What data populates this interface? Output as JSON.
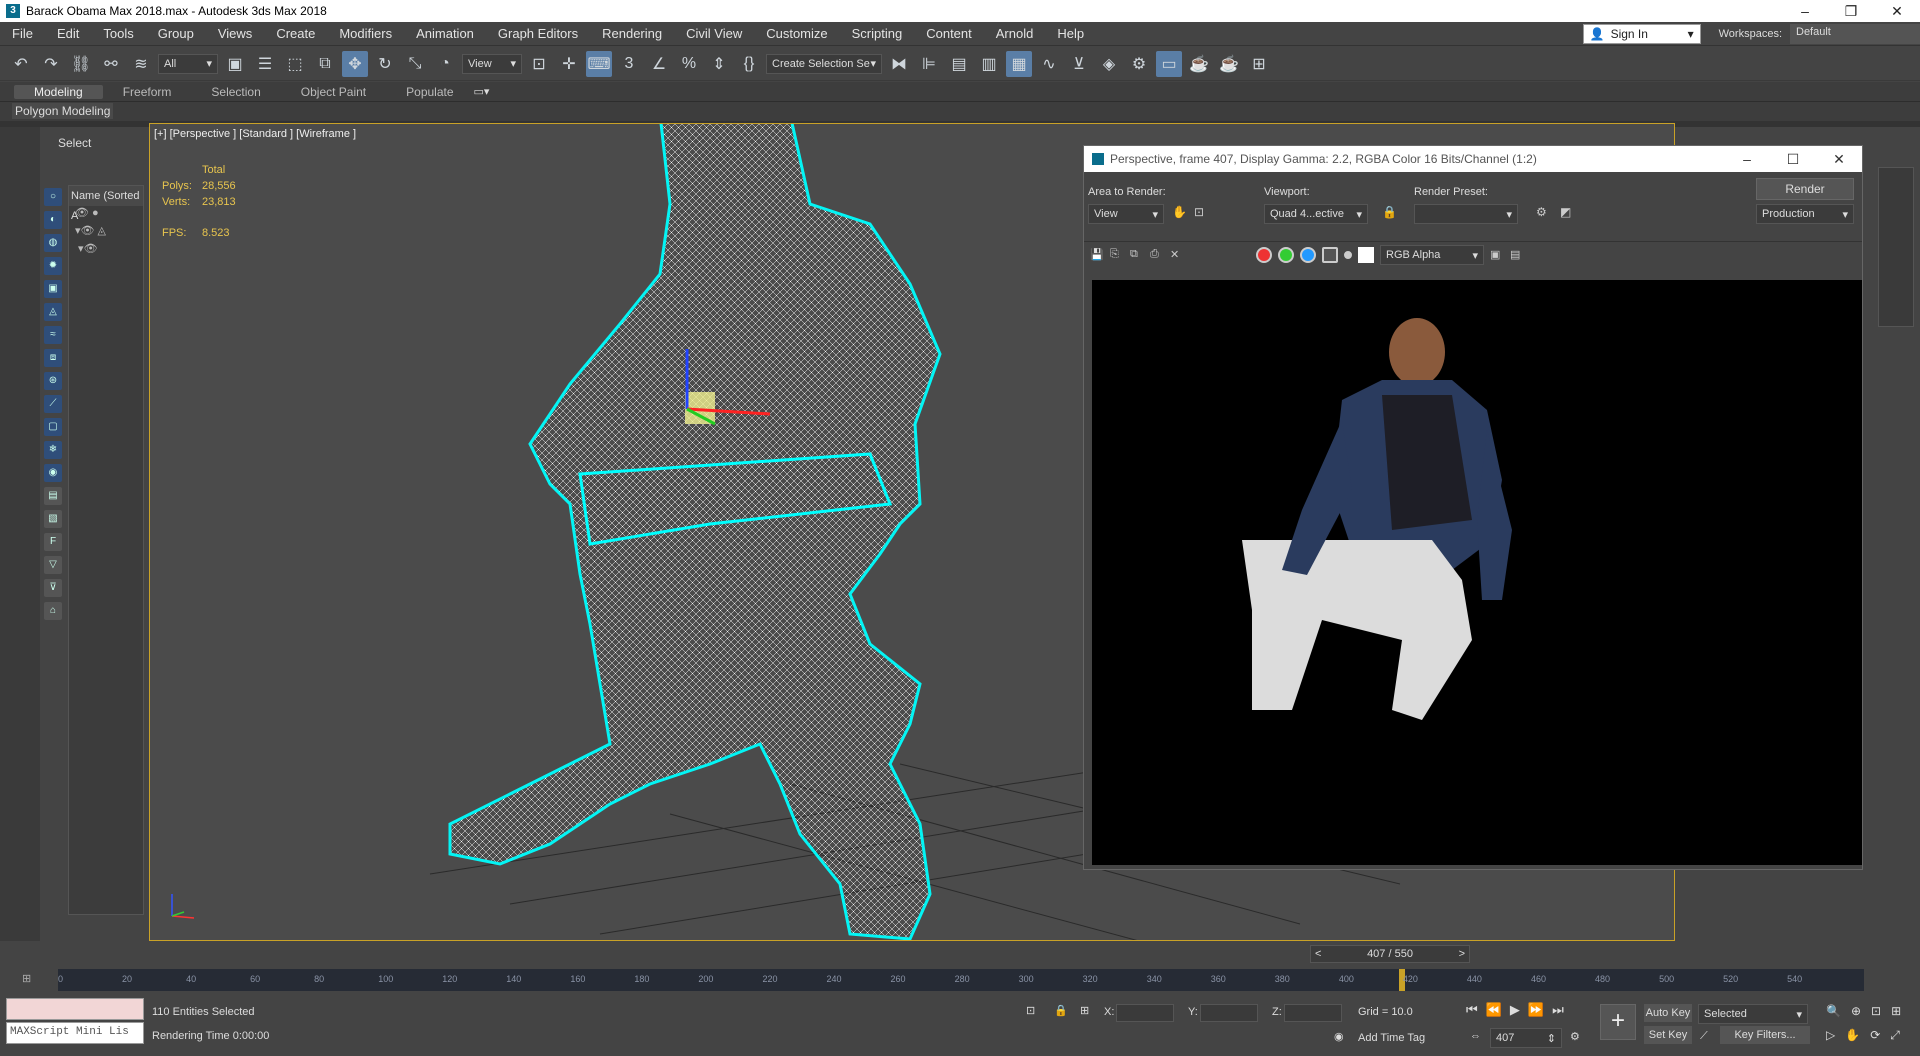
{
  "title_bar": {
    "title": "Barack Obama Max 2018.max - Autodesk 3ds Max 2018",
    "app_icon": "3ds-max-icon"
  },
  "menu": [
    "File",
    "Edit",
    "Tools",
    "Group",
    "Views",
    "Create",
    "Modifiers",
    "Animation",
    "Graph Editors",
    "Rendering",
    "Civil View",
    "Customize",
    "Scripting",
    "Content",
    "Arnold",
    "Help"
  ],
  "account": {
    "sign_in": "Sign In",
    "workspaces_label": "Workspaces:",
    "workspace_value": "Default"
  },
  "toolbar": {
    "selection_filter": "All",
    "ref_coord": "View",
    "named_selection": "Create Selection Se"
  },
  "ribbon": {
    "tabs": [
      "Modeling",
      "Freeform",
      "Selection",
      "Object Paint",
      "Populate"
    ],
    "active_tab": "Modeling",
    "panel": "Polygon Modeling"
  },
  "scene_explorer": {
    "select_label": "Select",
    "column_header": "Name (Sorted A"
  },
  "viewport": {
    "label": "[+] [Perspective ] [Standard ] [Wireframe ]",
    "stats": {
      "total_label": "Total",
      "polys_label": "Polys:",
      "polys_value": "28,556",
      "verts_label": "Verts:",
      "verts_value": "23,813",
      "fps_label": "FPS:",
      "fps_value": "8.523"
    }
  },
  "render_window": {
    "title": "Perspective, frame 407, Display Gamma: 2.2, RGBA Color 16 Bits/Channel (1:2)",
    "area_label": "Area to Render:",
    "area_value": "View",
    "viewport_label": "Viewport:",
    "viewport_value": "Quad 4...ective",
    "preset_label": "Render Preset:",
    "preset_value": "",
    "render_button": "Render",
    "production_value": "Production",
    "channel_value": "RGB Alpha"
  },
  "timeline": {
    "frame_display": "407 / 550",
    "ticks": [
      "0",
      "20",
      "40",
      "60",
      "80",
      "100",
      "120",
      "140",
      "160",
      "180",
      "200",
      "220",
      "240",
      "260",
      "280",
      "300",
      "320",
      "340",
      "360",
      "380",
      "400",
      "420",
      "440",
      "460",
      "480",
      "500",
      "520",
      "540"
    ]
  },
  "status": {
    "maxscript_label": "MAXScript Mini Lis",
    "selected_text": "110 Entities Selected",
    "render_time": "Rendering Time  0:00:00",
    "x_label": "X:",
    "y_label": "Y:",
    "z_label": "Z:",
    "grid": "Grid = 10.0",
    "add_time_tag": "Add Time Tag",
    "auto_key": "Auto Key",
    "set_key": "Set Key",
    "selected_dd": "Selected",
    "key_filters": "Key Filters...",
    "current_frame": "407"
  },
  "colors": {
    "accent_gold": "#c9a227",
    "stats_yellow": "#e8c54e",
    "selection_cyan": "#00ffff",
    "ui_bg": "#444444"
  }
}
